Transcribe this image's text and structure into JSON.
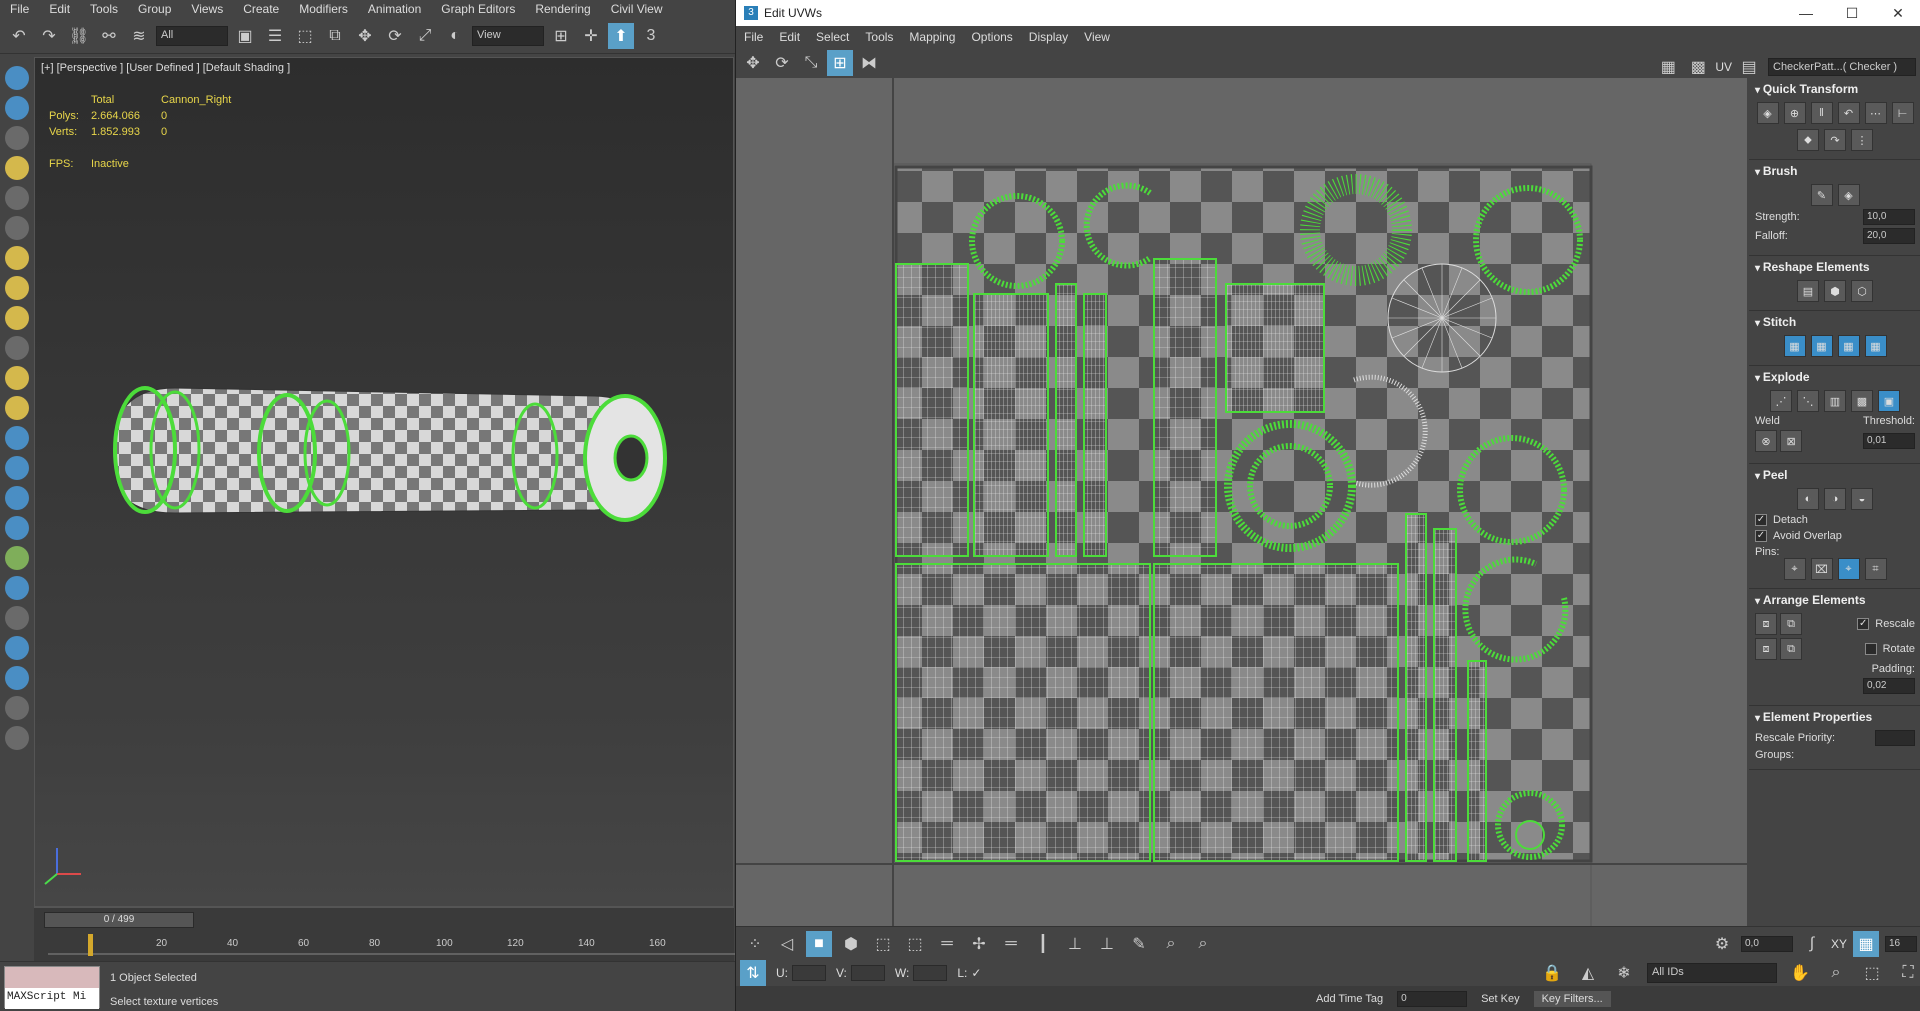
{
  "max": {
    "menu": [
      "File",
      "Edit",
      "Tools",
      "Group",
      "Views",
      "Create",
      "Modifiers",
      "Animation",
      "Graph Editors",
      "Rendering",
      "Civil View"
    ],
    "selection_filter": "All",
    "ref_coord": "View",
    "viewport_label": "[+] [Perspective ] [User Defined ] [Default Shading ]",
    "stats": {
      "header_total": "Total",
      "header_obj": "Cannon_Right",
      "polys_label": "Polys:",
      "polys_total": "2.664.066",
      "polys_obj": "0",
      "verts_label": "Verts:",
      "verts_total": "1.852.993",
      "verts_obj": "0",
      "fps_label": "FPS:",
      "fps_value": "Inactive"
    },
    "time_slider": "0 / 499",
    "ruler_ticks": [
      "20",
      "40",
      "60",
      "80",
      "100",
      "120",
      "140",
      "160"
    ],
    "maxscript_label": "MAXScript Mi",
    "status_selected": "1 Object Selected",
    "status_prompt": "Select texture vertices"
  },
  "uvw": {
    "title": "Edit UVWs",
    "menu": [
      "File",
      "Edit",
      "Select",
      "Tools",
      "Mapping",
      "Options",
      "Display",
      "View"
    ],
    "uv_label": "UV",
    "texture_map": "CheckerPatt...( Checker )",
    "sections": {
      "quick_transform": "Quick Transform",
      "brush": "Brush",
      "strength_label": "Strength:",
      "strength_value": "10,0",
      "falloff_label": "Falloff:",
      "falloff_value": "20,0",
      "reshape": "Reshape Elements",
      "stitch": "Stitch",
      "explode": "Explode",
      "weld": "Weld",
      "threshold_label": "Threshold:",
      "threshold_value": "0,01",
      "peel": "Peel",
      "detach": "Detach",
      "avoid_overlap": "Avoid Overlap",
      "pins": "Pins:",
      "arrange": "Arrange Elements",
      "rescale": "Rescale",
      "rotate": "Rotate",
      "padding_label": "Padding:",
      "padding_value": "0,02",
      "element_props": "Element Properties",
      "rescale_priority": "Rescale Priority:",
      "groups": "Groups:"
    },
    "bottom": {
      "angle_value": "0,0",
      "xy_label": "XY",
      "grid_value": "16",
      "u_label": "U:",
      "v_label": "V:",
      "w_label": "W:",
      "l_label": "L:",
      "ids_select": "All IDs"
    },
    "status": {
      "add_time_tag": "Add Time Tag",
      "frame": "0",
      "set_key": "Set Key",
      "key_filters": "Key Filters..."
    }
  }
}
